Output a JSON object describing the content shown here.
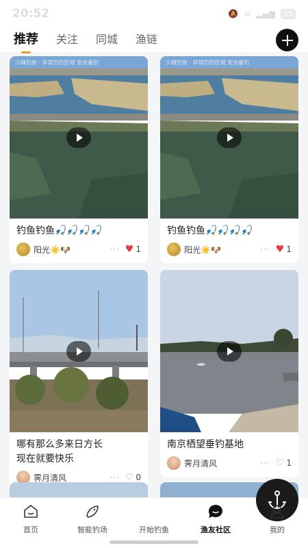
{
  "status": {
    "time": "20:52",
    "battery": "55"
  },
  "tabs": [
    {
      "label": "推荐",
      "active": true
    },
    {
      "label": "关注",
      "active": false
    },
    {
      "label": "同城",
      "active": false
    },
    {
      "label": "渔链",
      "active": false
    }
  ],
  "posts": [
    {
      "title": "钓鱼钓鱼🎣🎣🎣🎣",
      "author": "阳光☀️🐶",
      "likes": "1",
      "liked": true,
      "watermark": "少峰钓鱼 · 非禁钓钓区域 安全垂钓"
    },
    {
      "title": "钓鱼钓鱼🎣🎣🎣🎣",
      "author": "阳光☀️🐶",
      "likes": "1",
      "liked": true,
      "watermark": "少峰钓鱼 · 非禁钓钓区域 安全垂钓"
    },
    {
      "title": "哪有那么多来日方长\n现在就要快乐",
      "author": "霁月清风",
      "likes": "0",
      "liked": false
    },
    {
      "title": "南京栖望垂钓基地",
      "author": "霁月清风",
      "likes": "1",
      "liked": false
    }
  ],
  "bottom_nav": [
    {
      "label": "首页",
      "icon": "home-icon"
    },
    {
      "label": "智能钓场",
      "icon": "fish-icon"
    },
    {
      "label": "开始钓鱼",
      "icon": "anchor-icon"
    },
    {
      "label": "渔友社区",
      "icon": "chat-icon",
      "active": true
    },
    {
      "label": "我的",
      "icon": "profile-icon"
    }
  ],
  "colors": {
    "accent": "#f29a2e",
    "like": "#e23b4a",
    "dark": "#111111"
  }
}
